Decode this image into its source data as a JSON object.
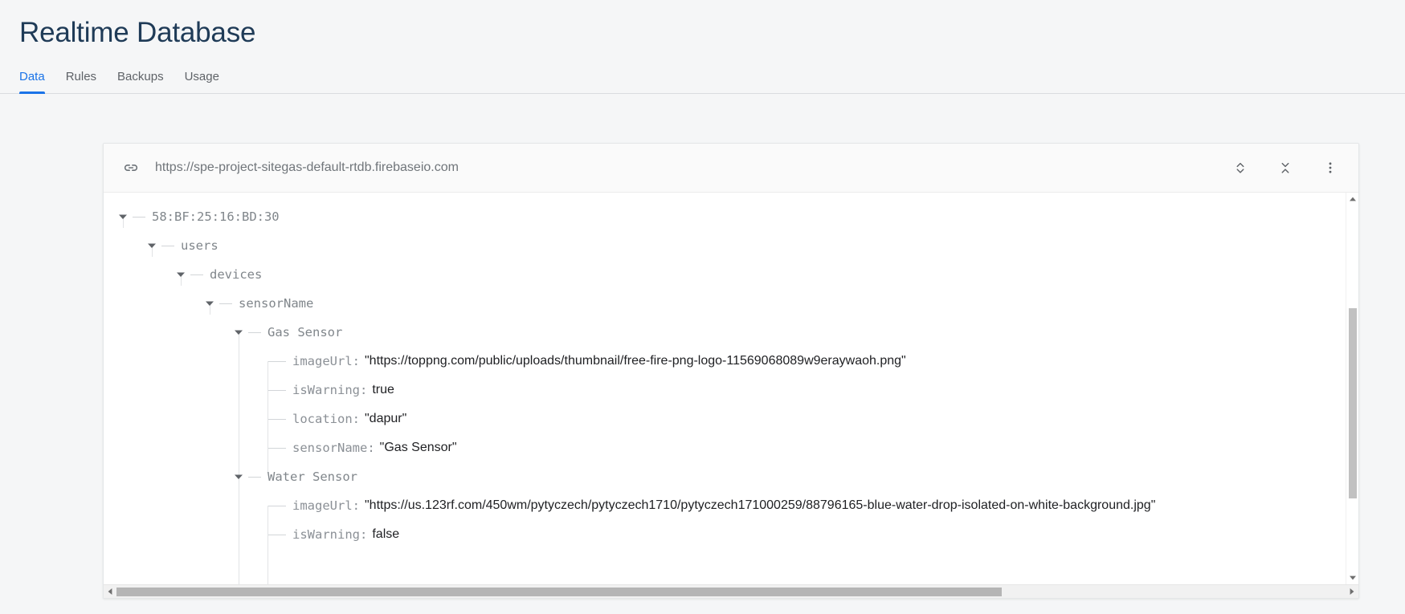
{
  "header": {
    "title": "Realtime Database"
  },
  "tabs": [
    {
      "label": "Data",
      "active": true
    },
    {
      "label": "Rules",
      "active": false
    },
    {
      "label": "Backups",
      "active": false
    },
    {
      "label": "Usage",
      "active": false
    }
  ],
  "toolbar": {
    "url": "https://spe-project-sitegas-default-rtdb.firebaseio.com",
    "link_icon": "link-icon",
    "expand_icon": "expand-all-icon",
    "collapse_icon": "collapse-all-icon",
    "more_icon": "more-vert-icon"
  },
  "tree": {
    "root_label": "58:BF:25:16:BD:30",
    "users_label": "users",
    "devices_label": "devices",
    "sensorname_label": "sensorName",
    "gas_sensor_label": "Gas Sensor",
    "water_sensor_label": "Water Sensor",
    "gas": {
      "imageUrl_key": "imageUrl",
      "imageUrl_value": "\"https://toppng.com/public/uploads/thumbnail/free-fire-png-logo-11569068089w9eraywaoh.png\"",
      "isWarning_key": "isWarning",
      "isWarning_value": "true",
      "location_key": "location",
      "location_value": "\"dapur\"",
      "sensorName_key": "sensorName",
      "sensorName_value": "\"Gas Sensor\""
    },
    "water": {
      "imageUrl_key": "imageUrl",
      "imageUrl_value": "\"https://us.123rf.com/450wm/pytyczech/pytyczech1710/pytyczech171000259/88796165-blue-water-drop-isolated-on-white-background.jpg\"",
      "isWarning_key": "isWarning",
      "isWarning_value": "false"
    },
    "colon": ":"
  },
  "colors": {
    "accent": "#1a73e8",
    "title": "#1f3b57",
    "key_gray": "#8b9096",
    "value_black": "#202124",
    "url_gray": "#70757a"
  },
  "scrollbars": {
    "v_up_icon": "scroll-up-arrow-icon",
    "v_down_icon": "scroll-down-arrow-icon",
    "h_left_icon": "scroll-left-arrow-icon",
    "h_right_icon": "scroll-right-arrow-icon"
  }
}
